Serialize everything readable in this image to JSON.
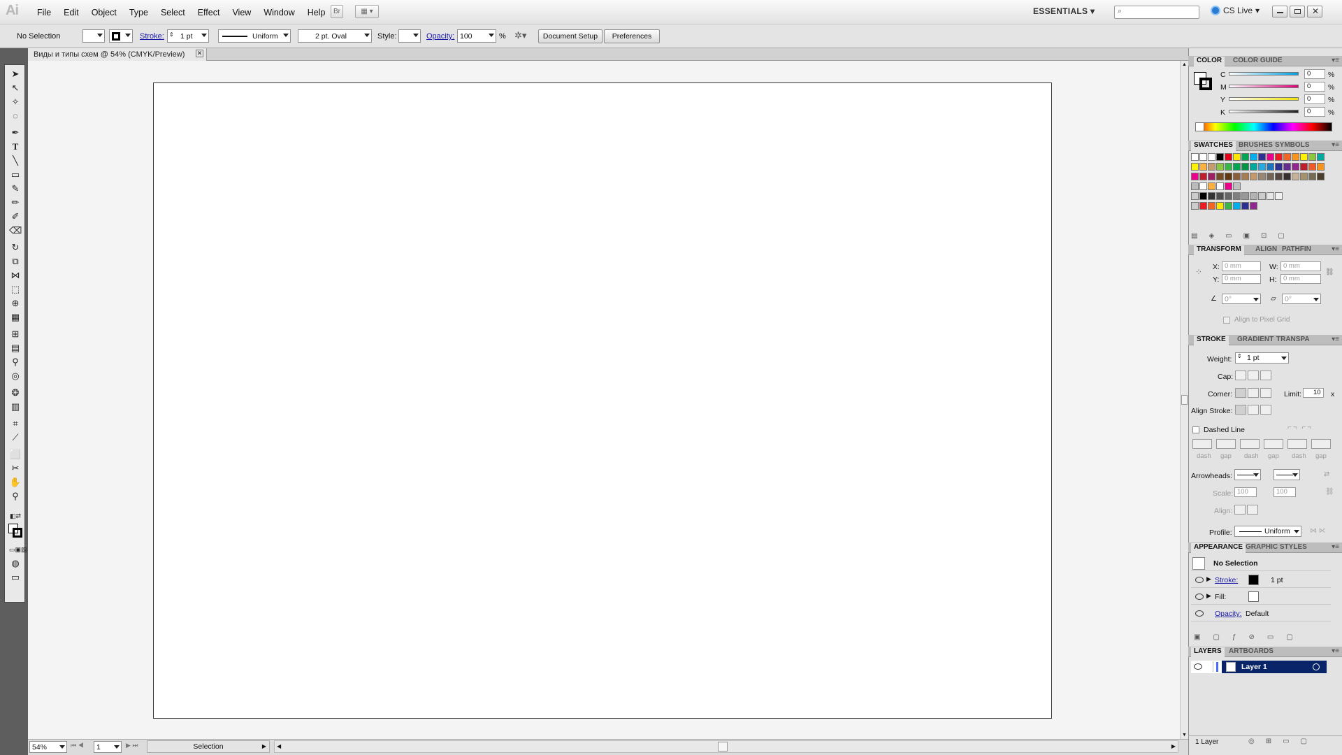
{
  "app": {
    "logo": "Ai",
    "menu": [
      "File",
      "Edit",
      "Object",
      "Type",
      "Select",
      "Effect",
      "View",
      "Window",
      "Help"
    ],
    "bridge": "Br",
    "workspace": "ESSENTIALS",
    "cslive": "CS Live"
  },
  "control": {
    "selection": "No Selection",
    "stroke_label": "Stroke:",
    "stroke_weight": "1 pt",
    "profile": "Uniform",
    "brush": "2 pt. Oval",
    "style_label": "Style:",
    "opacity_label": "Opacity:",
    "opacity_value": "100",
    "percent": "%",
    "doc_setup": "Document Setup",
    "preferences": "Preferences"
  },
  "document": {
    "tab_title": "Виды и типы схем @ 54% (CMYK/Preview)"
  },
  "status": {
    "zoom": "54%",
    "artboard_num": "1",
    "tool": "Selection"
  },
  "color_panel": {
    "tabs": [
      "COLOR",
      "COLOR GUIDE"
    ],
    "channels": [
      {
        "name": "C",
        "value": "0",
        "color": "#00a0e0"
      },
      {
        "name": "M",
        "value": "0",
        "color": "#e0007a"
      },
      {
        "name": "Y",
        "value": "0",
        "color": "#f2e400"
      },
      {
        "name": "K",
        "value": "0",
        "color": "#222222"
      }
    ],
    "unit": "%"
  },
  "swatches_panel": {
    "tabs": [
      "SWATCHES",
      "BRUSHES",
      "SYMBOLS"
    ]
  },
  "transform_panel": {
    "tabs": [
      "TRANSFORM",
      "ALIGN",
      "PATHFIN"
    ],
    "x_label": "X:",
    "x": "0 mm",
    "y_label": "Y:",
    "y": "0 mm",
    "w_label": "W:",
    "w": "0 mm",
    "h_label": "H:",
    "h": "0 mm",
    "angle": "0°",
    "shear": "0°",
    "align_pixel": "Align to Pixel Grid"
  },
  "stroke_panel": {
    "tabs": [
      "STROKE",
      "GRADIENT",
      "TRANSPA"
    ],
    "weight_label": "Weight:",
    "weight": "1 pt",
    "cap_label": "Cap:",
    "corner_label": "Corner:",
    "limit_label": "Limit:",
    "limit": "10",
    "limit_unit": "x",
    "align_label": "Align Stroke:",
    "dashed": "Dashed Line",
    "dash_labels": [
      "dash",
      "gap",
      "dash",
      "gap",
      "dash",
      "gap"
    ],
    "arrowheads": "Arrowheads:",
    "scale_label": "Scale:",
    "scale1": "100",
    "scale2": "100",
    "align2_label": "Align:",
    "profile_label": "Profile:",
    "profile": "Uniform"
  },
  "appearance_panel": {
    "tabs": [
      "APPEARANCE",
      "GRAPHIC STYLES"
    ],
    "title": "No Selection",
    "stroke_label": "Stroke:",
    "stroke_value": "1 pt",
    "fill_label": "Fill:",
    "opacity_label": "Opacity:",
    "opacity_value": "Default"
  },
  "layers_panel": {
    "tabs": [
      "LAYERS",
      "ARTBOARDS"
    ],
    "layer_name": "Layer 1",
    "count": "1 Layer"
  }
}
